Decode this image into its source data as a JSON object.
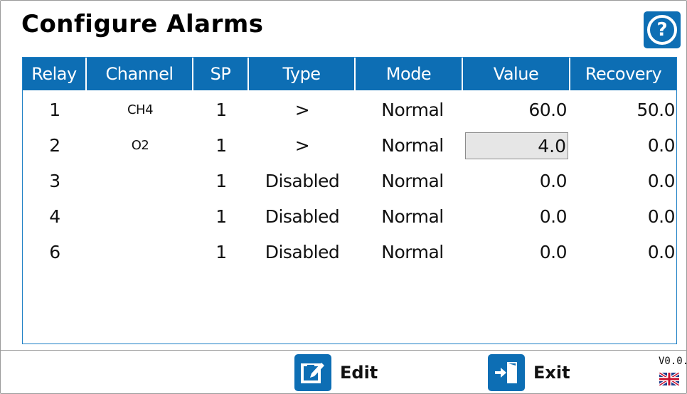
{
  "header": {
    "title": "Configure Alarms"
  },
  "help": {
    "icon": "help-icon"
  },
  "table": {
    "columns": [
      "Relay",
      "Channel",
      "SP",
      "Type",
      "Mode",
      "Value",
      "Recovery"
    ],
    "rows": [
      {
        "relay": "1",
        "channel": "CH4",
        "sp": "1",
        "type": ">",
        "mode": "Normal",
        "value": "60.0",
        "recovery": "50.0"
      },
      {
        "relay": "2",
        "channel": "O2",
        "sp": "1",
        "type": ">",
        "mode": "Normal",
        "value": "4.0",
        "recovery": "0.0"
      },
      {
        "relay": "3",
        "channel": "",
        "sp": "1",
        "type": "Disabled",
        "mode": "Normal",
        "value": "0.0",
        "recovery": "0.0"
      },
      {
        "relay": "4",
        "channel": "",
        "sp": "1",
        "type": "Disabled",
        "mode": "Normal",
        "value": "0.0",
        "recovery": "0.0"
      },
      {
        "relay": "6",
        "channel": "",
        "sp": "1",
        "type": "Disabled",
        "mode": "Normal",
        "value": "0.0",
        "recovery": "0.0"
      }
    ],
    "selected_row": 1
  },
  "footer": {
    "edit_label": "Edit",
    "exit_label": "Exit",
    "version": "V0.0.",
    "language_icon": "uk-flag-icon"
  },
  "colors": {
    "accent": "#0d6eb4",
    "border": "#1f80c6",
    "selected_field": "#e6e6e6"
  }
}
